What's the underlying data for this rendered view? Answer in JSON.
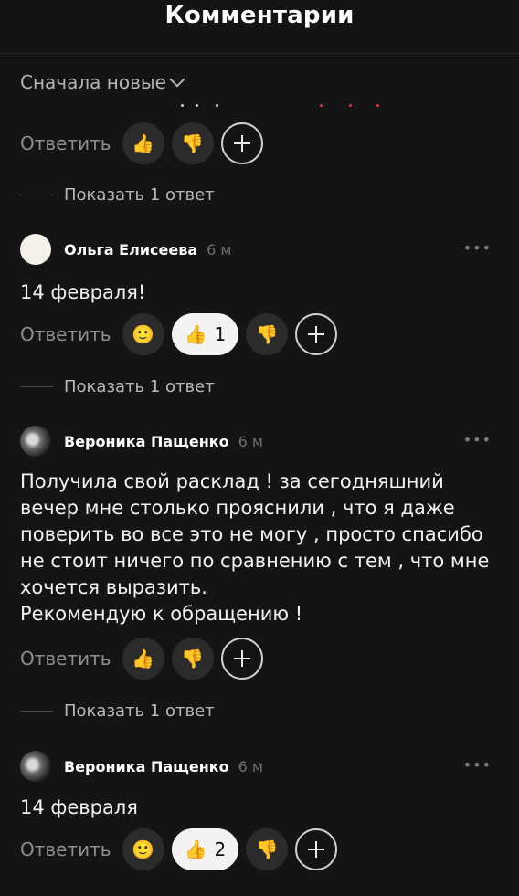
{
  "header": {
    "title": "Комментарии"
  },
  "sort": {
    "label": "Сначала новые"
  },
  "actions": {
    "reply_label": "Ответить",
    "plus_icon": "plus-icon"
  },
  "show_replies_label": "Показать 1 ответ",
  "comments": [
    {
      "reactions": {
        "like": "",
        "dislike": ""
      }
    },
    {
      "author": "Ольга Елисеева",
      "time": "6 м",
      "text": "14 февраля!",
      "reactions": {
        "like_count": "1"
      }
    },
    {
      "author": "Вероника Пащенко",
      "time": "6 м",
      "text": "Получила свой расклад ! за сегодняшний\nвечер мне столько прояснили , что я даже\nповерить во все это не могу , просто спасибо\nне стоит ничего по сравнению с тем , что мне\nхочется выразить.\nРекомендую к обращению !"
    },
    {
      "author": "Вероника Пащенко",
      "time": "6 м",
      "text": "14 февраля",
      "reactions": {
        "like_count": "2"
      }
    }
  ],
  "more_icon": "•••"
}
